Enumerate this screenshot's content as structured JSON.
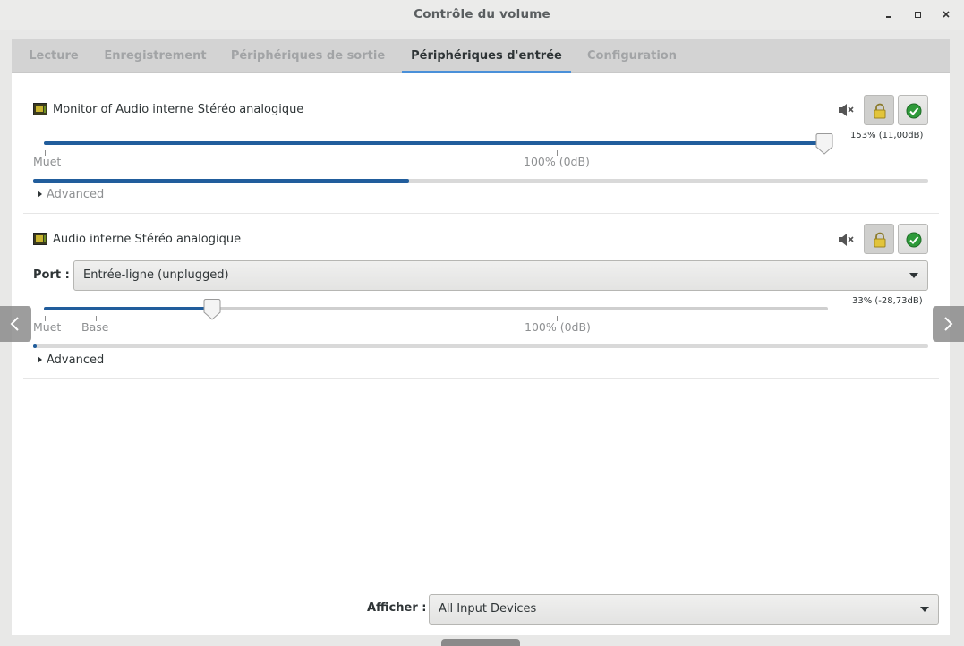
{
  "window": {
    "title": "Contrôle du volume"
  },
  "tabs": [
    {
      "label": "Lecture"
    },
    {
      "label": "Enregistrement"
    },
    {
      "label": "Périphériques de sortie"
    },
    {
      "label": "Périphériques d'entrée"
    },
    {
      "label": "Configuration"
    }
  ],
  "active_tab": "Périphériques d'entrée",
  "devices": [
    {
      "name": "Monitor of Audio interne Stéréo analogique",
      "volume_percent": 153,
      "volume_readout": "153% (11,00dB)",
      "level_fraction": 0.42,
      "tick_muet": "Muet",
      "tick_100": "100% (0dB)",
      "advanced_label": "Advanced"
    },
    {
      "name": "Audio interne Stéréo analogique",
      "port_label": "Port :",
      "port_value": "Entrée-ligne (unplugged)",
      "volume_percent": 33,
      "volume_readout": "33% (-28,73dB)",
      "level_fraction": 0.004,
      "tick_muet": "Muet",
      "tick_base": "Base",
      "tick_100": "100% (0dB)",
      "advanced_label": "Advanced"
    }
  ],
  "footer": {
    "afficher_label": "Afficher :",
    "afficher_value": "All Input Devices"
  },
  "colors": {
    "accent": "#4a90d9",
    "slider_fill": "#215d9c",
    "default_check": "#2e9a3a"
  },
  "icons": [
    "microphone-card-icon",
    "speaker-mute-icon",
    "lock-icon",
    "checkmark-icon",
    "chevron-left-icon",
    "chevron-right-icon",
    "dropdown-arrow-icon"
  ]
}
